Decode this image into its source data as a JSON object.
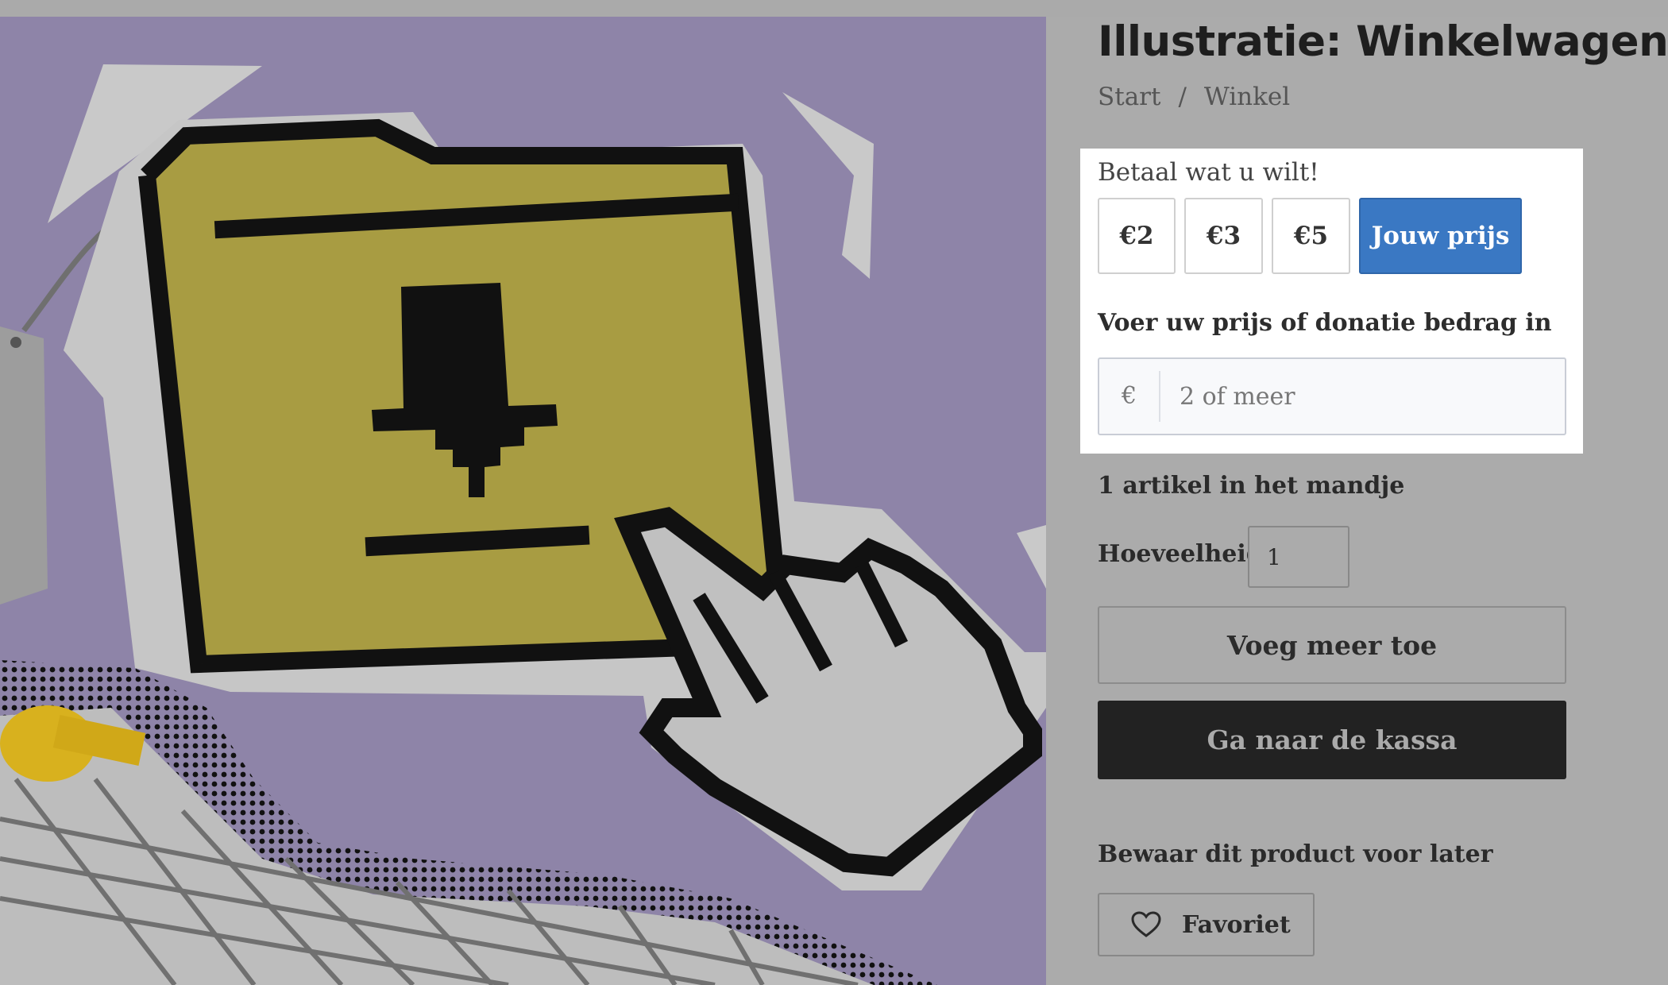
{
  "product": {
    "title": "Illustratie: Winkelwagen",
    "illustration_icons": [
      "folder-download-icon",
      "pointer-hand-icon",
      "price-tag-icon",
      "shopping-cart-icon"
    ]
  },
  "breadcrumb": [
    {
      "label": "Start"
    },
    {
      "label": "Winkel"
    }
  ],
  "breadcrumb_separator": "/",
  "pricing": {
    "heading": "Betaal wat u wilt!",
    "options": [
      "€2",
      "€3",
      "€5",
      "Jouw prijs"
    ],
    "selected": "Jouw prijs",
    "donation_label": "Voer uw prijs of donatie bedrag in",
    "currency_symbol": "€",
    "donation_placeholder": "2 of meer"
  },
  "cart": {
    "count_text": "1 artikel in het mandje",
    "quantity_label": "Hoeveelheid:",
    "quantity_value": "1",
    "add_more_label": "Voeg meer toe",
    "checkout_label": "Ga naar de kassa"
  },
  "wishlist": {
    "heading": "Bewaar dit product voor later",
    "button_label": "Favoriet",
    "icon": "heart-icon"
  },
  "colors": {
    "accent": "#3a78c3",
    "checkout_bg": "#222222",
    "illustration_bg": "#8e84a8",
    "folder": "#a89c42",
    "overlay": "#ababab"
  }
}
